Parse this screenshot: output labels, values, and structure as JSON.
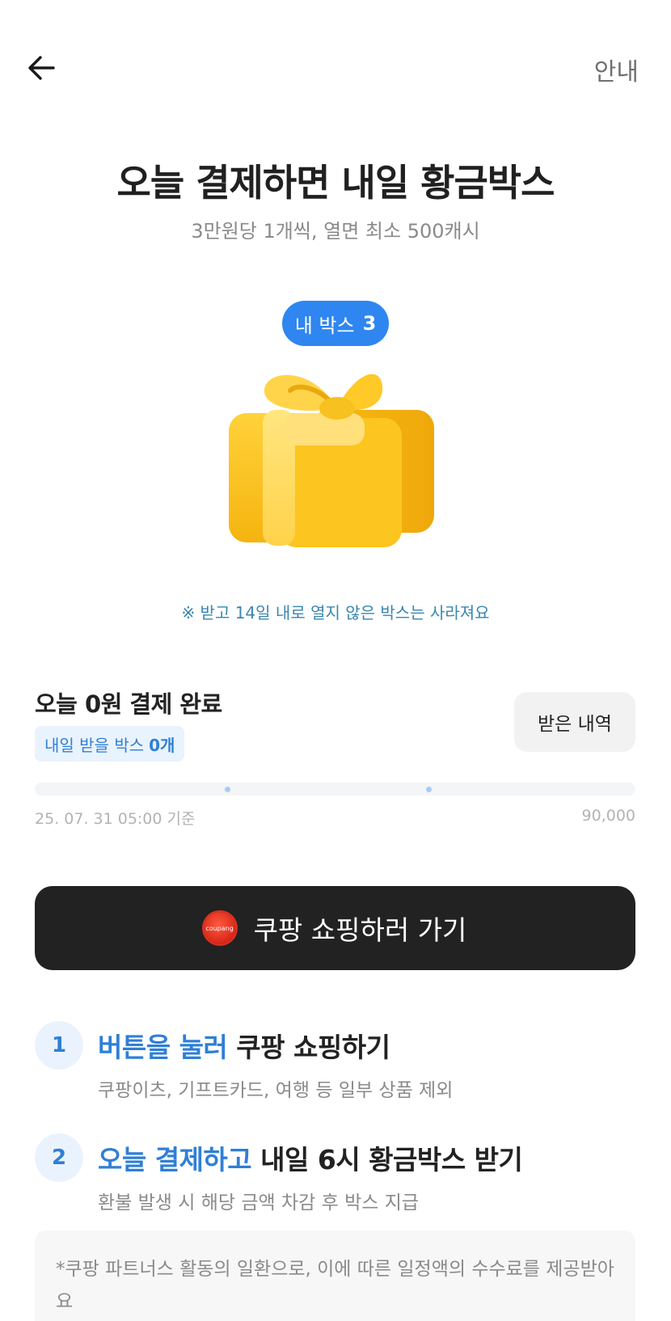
{
  "header": {
    "back_icon": "arrow-left-icon",
    "info_label": "안내"
  },
  "hero": {
    "title": "오늘 결제하면 내일 황금박스",
    "subtitle": "3만원당 1개씩, 열면 최소 500캐시",
    "my_box_label": "내 박스",
    "my_box_count": "3",
    "gift_icon": "gift-box-icon",
    "notice": "※ 받고 14일 내로 열지 않은 박스는 사라져요"
  },
  "status": {
    "title": "오늘 0원 결제 완료",
    "tomorrow_label": "내일 받을 박스",
    "tomorrow_count": "0개",
    "history_button": "받은 내역",
    "progress_fraction": 0,
    "progress_left_label": "25. 07. 31 05:00 기준",
    "progress_right_label": "90,000"
  },
  "cta": {
    "label": "쿠팡 쇼핑하러 가기",
    "logo_text": "coupang"
  },
  "steps": [
    {
      "num": "1",
      "highlight": "버튼을 눌러",
      "rest": " 쿠팡 쇼핑하기",
      "desc": "쿠팡이츠, 기프트카드, 여행 등 일부 상품 제외"
    },
    {
      "num": "2",
      "highlight": "오늘 결제하고",
      "rest": " 내일 6시 황금박스 받기",
      "desc": "환불 발생 시 해당 금액 차감 후 박스 지급"
    }
  ],
  "footnote": "*쿠팡 파트너스 활동의 일환으로, 이에 따른 일정액의 수수료를 제공받아요",
  "colors": {
    "accent": "#2f86f0",
    "dark_button": "#222222",
    "gift": "#f7c31c"
  }
}
